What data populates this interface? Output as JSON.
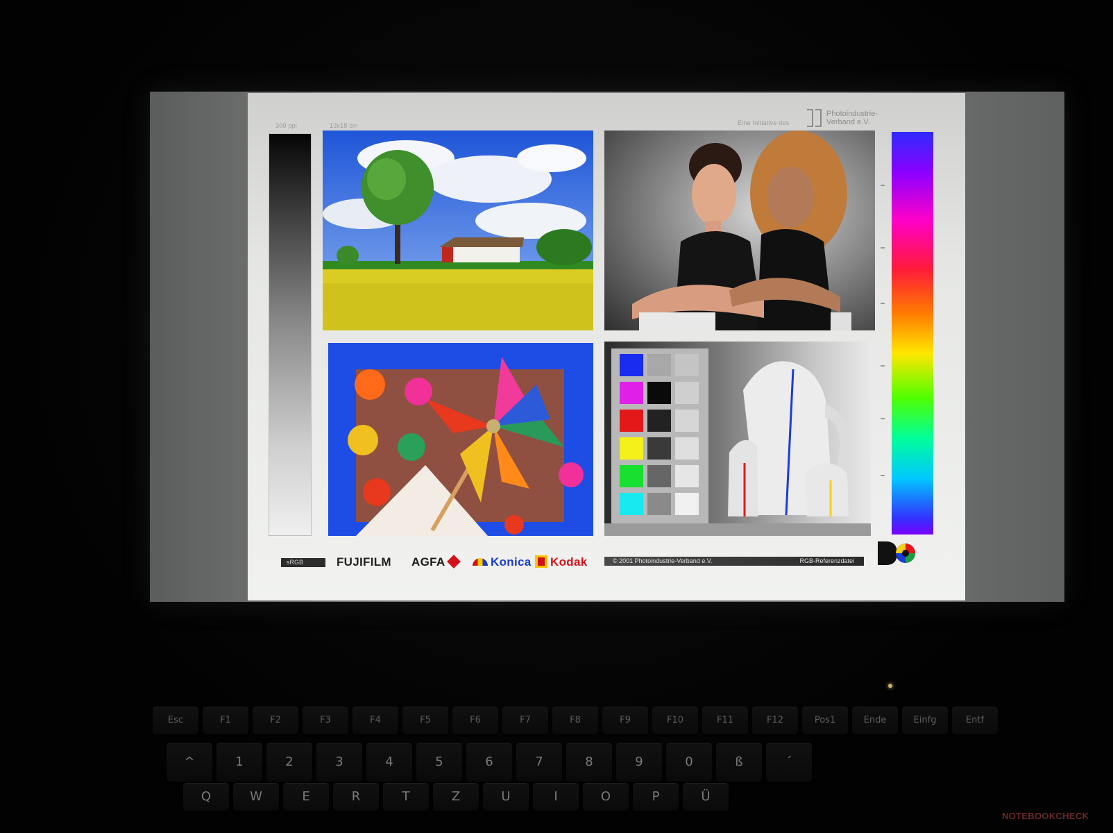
{
  "chart": {
    "ppi_label": "300 ppi",
    "size_label": "13x18 cm",
    "initiative_label": "Eine Initiative des",
    "verband_name_line1": "Photoindustrie-",
    "verband_name_line2": "Verband e.V.",
    "srgb_tag": "sRGB",
    "brands": [
      "FUJIFILM",
      "AGFA",
      "Konica",
      "Kodak"
    ],
    "copyright": "© 2001 Photoindustrie-Verband e.V.",
    "reference_label": "RGB-Referenzdatei"
  },
  "keyboard": {
    "function_row": [
      "Esc",
      "F1",
      "F2",
      "F3",
      "F4",
      "F5",
      "F6",
      "F7",
      "F8",
      "F9",
      "F10",
      "F11",
      "F12",
      "Pos1",
      "Ende",
      "Einfg",
      "Entf"
    ],
    "number_row": [
      "^",
      "1",
      "2",
      "3",
      "4",
      "5",
      "6",
      "7",
      "8",
      "9",
      "0",
      "ß",
      "´"
    ],
    "letter_row": [
      "Q",
      "W",
      "E",
      "R",
      "T",
      "Z",
      "U",
      "I",
      "O",
      "P",
      "Ü"
    ]
  },
  "watermark": "NOTEBOOKCHECK",
  "colors": {
    "kodak_red": "#d1121a",
    "konica_blue": "#1a3bc8",
    "kodak_yellow": "#f7c600"
  }
}
